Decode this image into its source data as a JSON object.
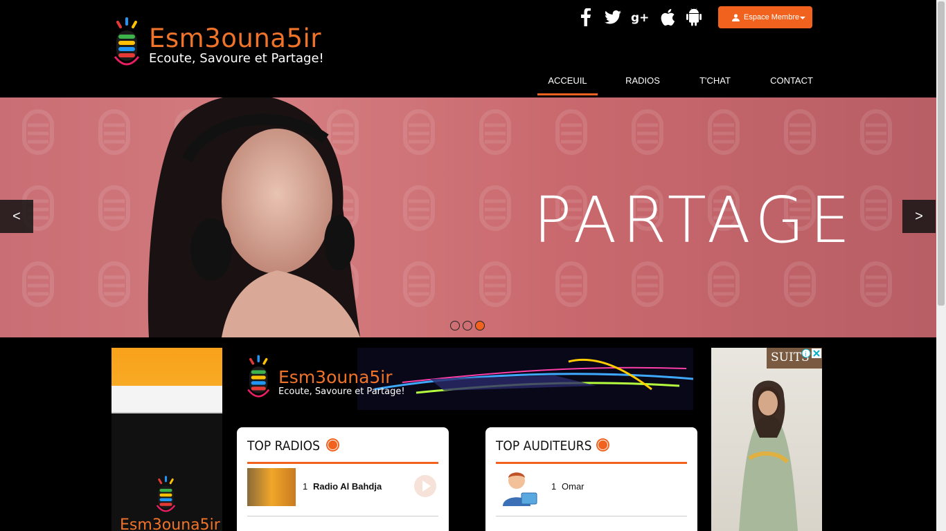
{
  "header": {
    "logo_title": "Esm3ouna5ir",
    "logo_tagline": "Ecoute, Savoure et Partage!",
    "social_icons": [
      "facebook-icon",
      "twitter-icon",
      "google-plus-icon",
      "apple-icon",
      "android-icon"
    ],
    "member_button": "Espace Membre",
    "nav": [
      {
        "label": "ACCEUIL",
        "active": true
      },
      {
        "label": "RADIOS",
        "active": false
      },
      {
        "label": "T'CHAT",
        "active": false
      },
      {
        "label": "CONTACT",
        "active": false
      }
    ]
  },
  "slider": {
    "caption": "PARTAGE",
    "prev_label": "<",
    "next_label": ">",
    "slide_count": 3,
    "active_slide": 3
  },
  "banner": {
    "title": "Esm3ouna5ir",
    "tagline": "Ecoute, Savoure et Partage!"
  },
  "ad_left": {
    "text": "Esm3ouna5ir"
  },
  "ad_right": {
    "brand": "SUITS"
  },
  "top_radios": {
    "title": "TOP RADIOS",
    "items": [
      {
        "rank": "1",
        "name": "Radio Al Bahdja"
      }
    ]
  },
  "top_listeners": {
    "title": "TOP AUDITEURS",
    "items": [
      {
        "rank": "1",
        "name": "Omar"
      }
    ]
  },
  "colors": {
    "accent": "#f0621d",
    "logo_orange": "#f0732a",
    "slider_bg": "#c96e74"
  }
}
